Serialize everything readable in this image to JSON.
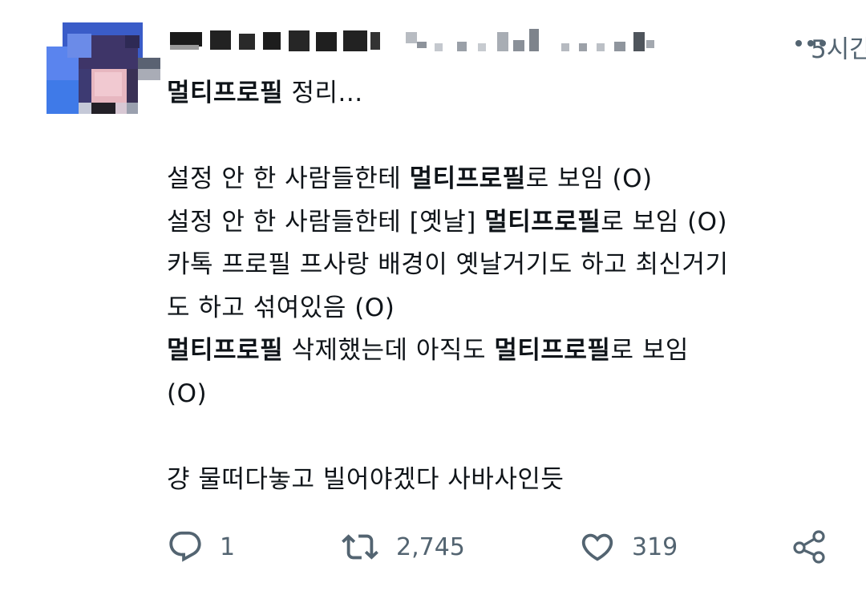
{
  "post": {
    "time": "5시간",
    "more_icon": "more-horizontal-icon",
    "lines": [
      [
        {
          "t": "멀티프로필",
          "b": true
        },
        {
          "t": " 정리...",
          "b": false
        }
      ],
      [],
      [
        {
          "t": "설정 안 한 사람들한테 ",
          "b": false
        },
        {
          "t": "멀티프로필",
          "b": true
        },
        {
          "t": "로 보임 (O)",
          "b": false
        }
      ],
      [
        {
          "t": "설정 안 한 사람들한테 [옛날] ",
          "b": false
        },
        {
          "t": "멀티프로필",
          "b": true
        },
        {
          "t": "로 보임  (O)",
          "b": false
        }
      ],
      [
        {
          "t": "카톡 프로필 프사랑 배경이 옛날거기도 하고 최신거기",
          "b": false
        }
      ],
      [
        {
          "t": "도 하고 섞여있음 (O)",
          "b": false
        }
      ],
      [
        {
          "t": "멀티프로필",
          "b": true
        },
        {
          "t": " 삭제했는데 아직도 ",
          "b": false
        },
        {
          "t": "멀티프로필",
          "b": true
        },
        {
          "t": "로 보임",
          "b": false
        }
      ],
      [
        {
          "t": "(O)",
          "b": false
        }
      ],
      [],
      [
        {
          "t": "걍 물떠다놓고 빌어야겠다 사바사인듯",
          "b": false
        }
      ]
    ]
  },
  "actions": {
    "reply": {
      "icon": "reply-icon",
      "count": "1"
    },
    "retweet": {
      "icon": "retweet-icon",
      "count": "2,745"
    },
    "like": {
      "icon": "heart-icon",
      "count": "319"
    },
    "share": {
      "icon": "share-icon"
    }
  },
  "colors": {
    "text": "#0f1419",
    "secondary": "#536471",
    "background": "#ffffff"
  }
}
